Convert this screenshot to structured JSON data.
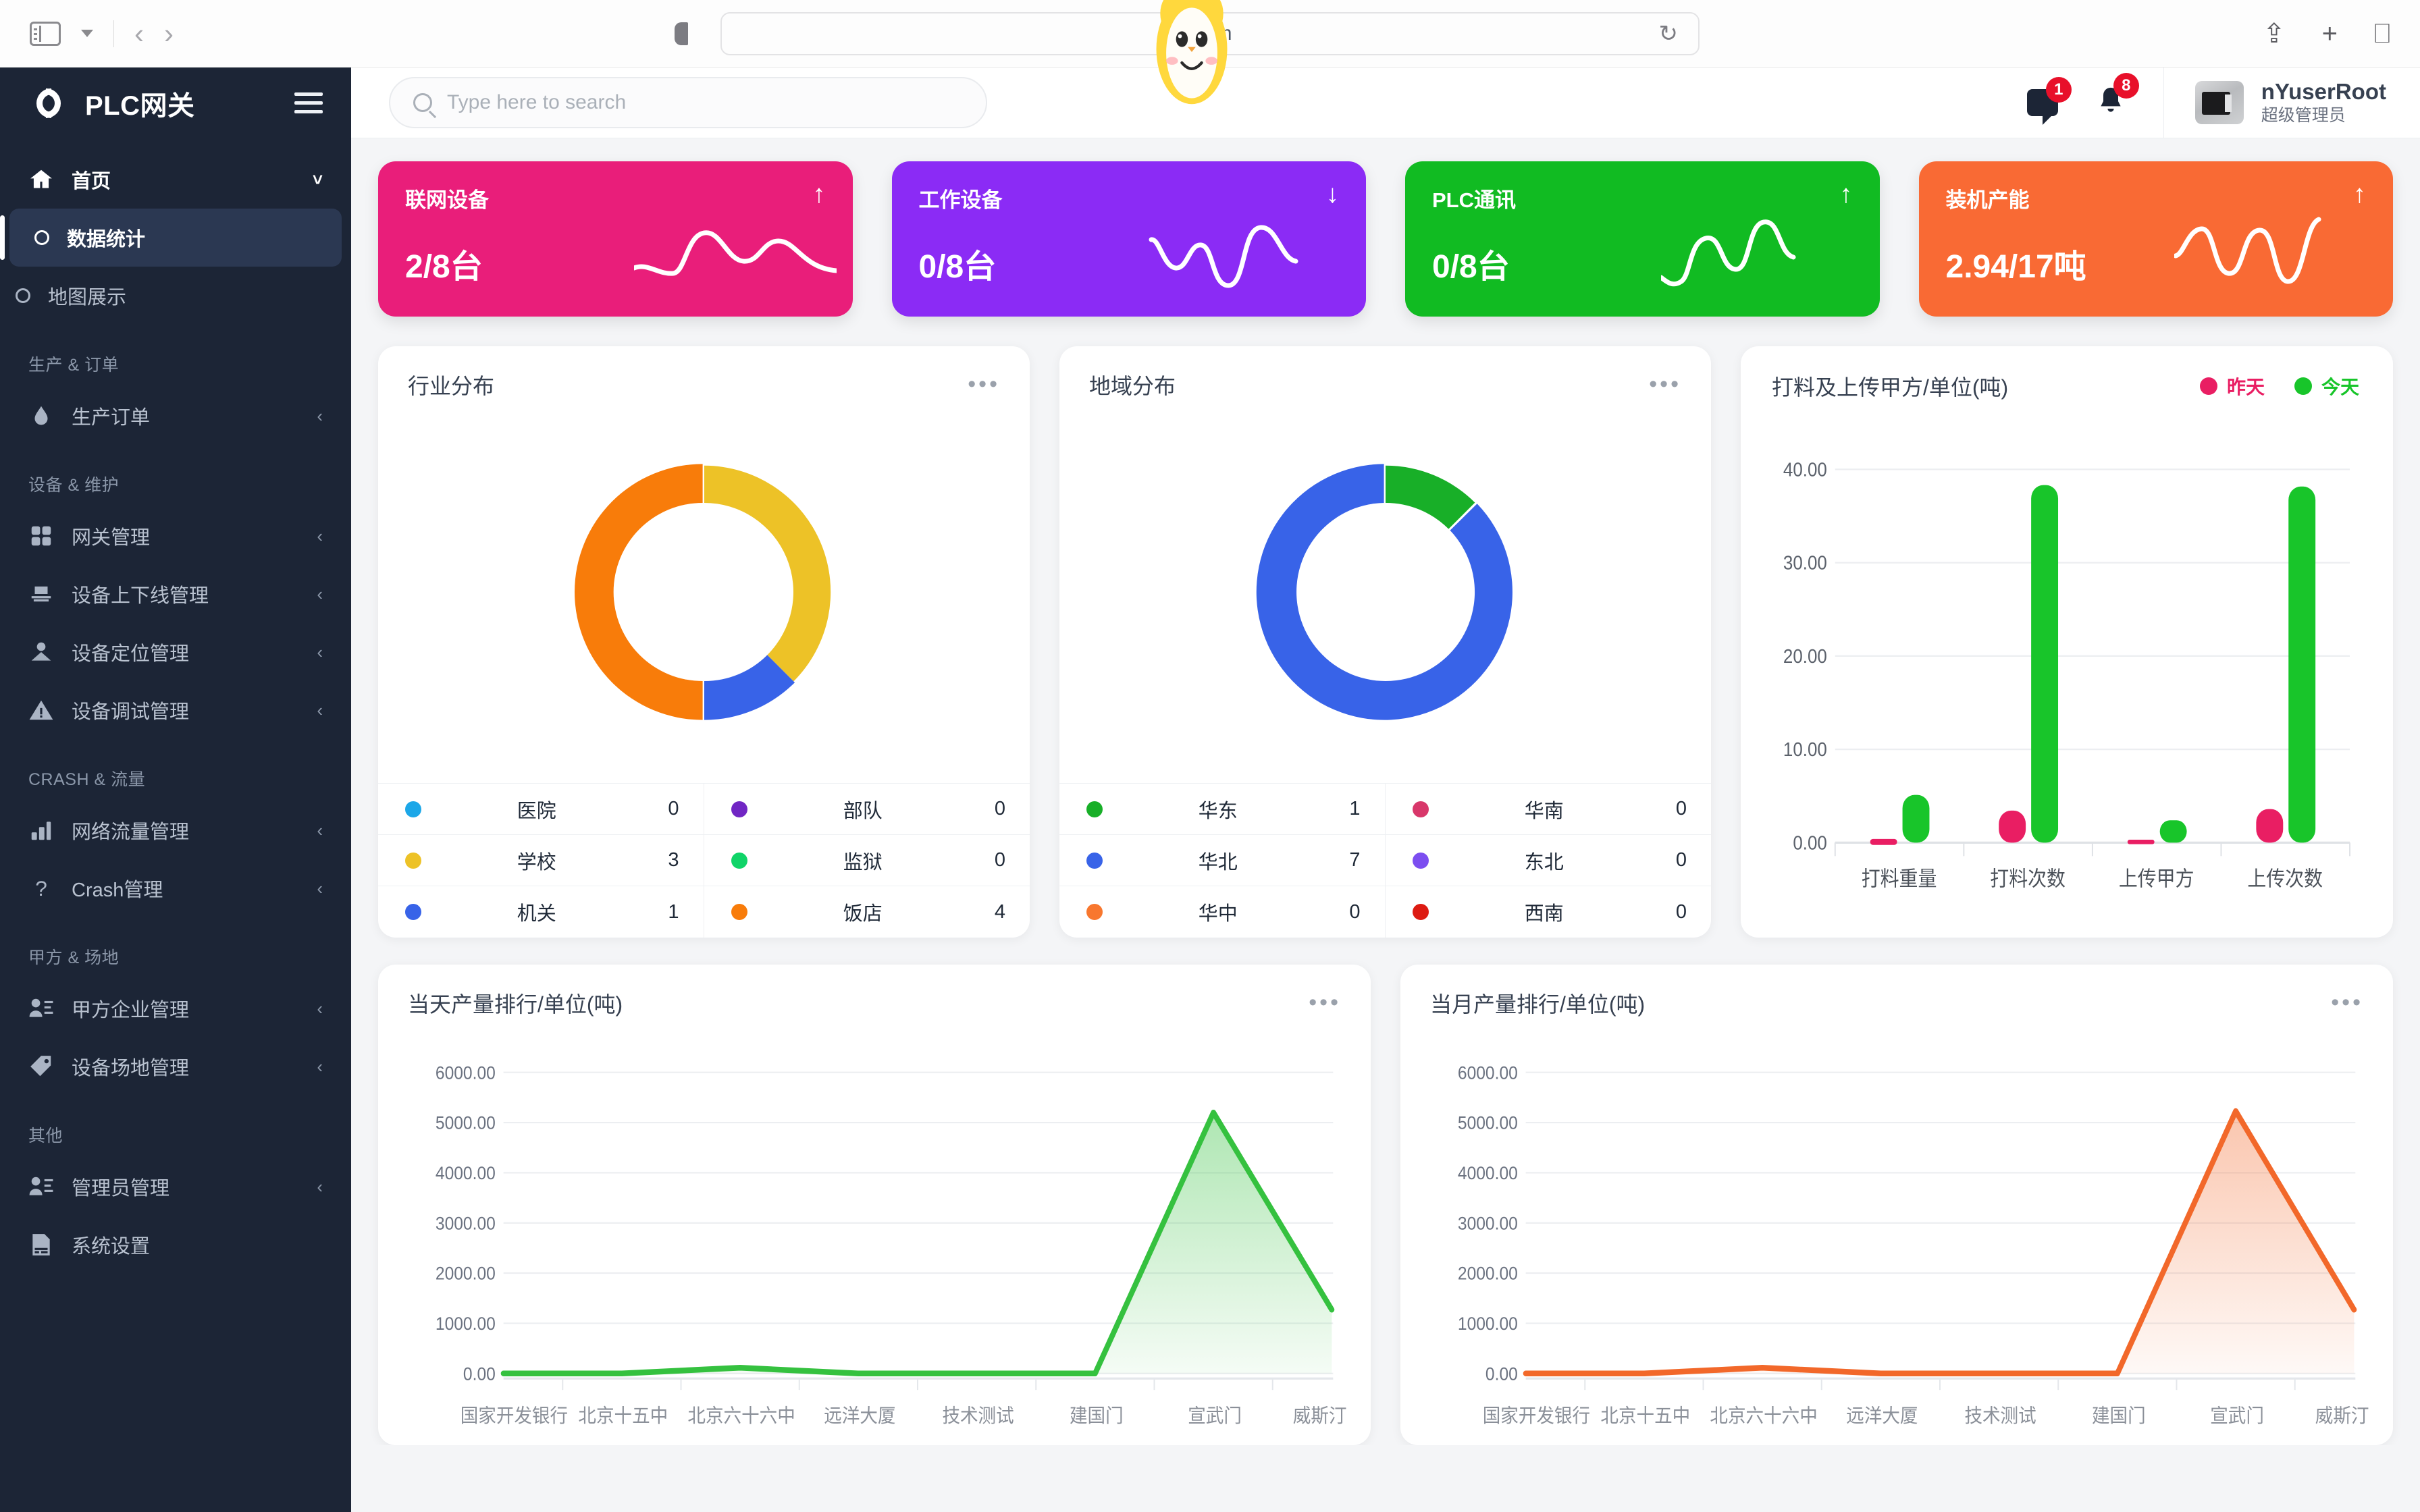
{
  "browser": {
    "url": ".com",
    "back_icon": "chevron-left-icon",
    "forward_icon": "chevron-right-icon",
    "sidebar_icon": "sidebar-toggle-icon",
    "shield_icon": "shield-icon",
    "reload_icon": "reload-icon",
    "share_icon": "share-icon",
    "new_tab_icon": "plus-icon",
    "tabs_icon": "tabs-overview-icon"
  },
  "sidebar": {
    "brand": "PLC网关",
    "logo_icon": "plc-logo-icon",
    "hamburger_icon": "hamburger-icon",
    "items": [
      {
        "label": "首页",
        "icon": "home-icon",
        "type": "parent",
        "active": true,
        "expanded": true
      },
      {
        "label": "数据统计",
        "icon": "circle-icon",
        "type": "child",
        "active": true
      },
      {
        "label": "地图展示",
        "icon": "circle-icon",
        "type": "child",
        "active": false
      }
    ],
    "groups": [
      {
        "title": "生产 & 订单",
        "items": [
          {
            "label": "生产订单",
            "icon": "drop-icon"
          }
        ]
      },
      {
        "title": "设备 & 维护",
        "items": [
          {
            "label": "网关管理",
            "icon": "grid-icon"
          },
          {
            "label": "设备上下线管理",
            "icon": "device-icon"
          },
          {
            "label": "设备定位管理",
            "icon": "location-pin-icon"
          },
          {
            "label": "设备调试管理",
            "icon": "warning-triangle-icon"
          }
        ]
      },
      {
        "title": "CRASH & 流量",
        "items": [
          {
            "label": "网络流量管理",
            "icon": "bar-chart-icon"
          },
          {
            "label": "Crash管理",
            "icon": "question-mark-icon"
          }
        ]
      },
      {
        "title": "甲方 & 场地",
        "items": [
          {
            "label": "甲方企业管理",
            "icon": "user-list-icon"
          },
          {
            "label": "设备场地管理",
            "icon": "tag-icon"
          }
        ]
      },
      {
        "title": "其他",
        "items": [
          {
            "label": "管理员管理",
            "icon": "user-list-icon"
          },
          {
            "label": "系统设置",
            "icon": "settings-card-icon"
          }
        ]
      }
    ]
  },
  "topbar": {
    "search_placeholder": "Type here to search",
    "search_value": "",
    "search_icon": "search-icon",
    "chat_icon": "chat-icon",
    "chat_badge": "1",
    "bell_icon": "bell-icon",
    "bell_badge": "8",
    "avatar_icon": "avatar",
    "user_name": "nYuserRoot",
    "user_role": "超级管理员"
  },
  "kpis": [
    {
      "title": "联网设备",
      "value": "2/8台",
      "arrow": "↑",
      "color": "#e91e7a"
    },
    {
      "title": "工作设备",
      "value": "0/8台",
      "arrow": "↓",
      "color": "#8b2bf5"
    },
    {
      "title": "PLC通讯",
      "value": "0/8台",
      "arrow": "↑",
      "color": "#11bb22"
    },
    {
      "title": "装机产能",
      "value": "2.94/17吨",
      "arrow": "↑",
      "color": "#f96a34"
    }
  ],
  "chart_data": [
    {
      "type": "pie",
      "title": "行业分布",
      "legend_position": "bottom",
      "categories": [
        "医院",
        "学校",
        "机关",
        "部队",
        "监狱",
        "饭店"
      ],
      "values": [
        0,
        3,
        1,
        0,
        0,
        4
      ],
      "colors": [
        "#1ca7e8",
        "#edc227",
        "#3863e8",
        "#7126c4",
        "#10d468",
        "#f87c0a"
      ]
    },
    {
      "type": "pie",
      "title": "地域分布",
      "legend_position": "bottom",
      "categories": [
        "华东",
        "华北",
        "华中",
        "华南",
        "东北",
        "西南"
      ],
      "values": [
        1,
        7,
        0,
        0,
        0,
        0
      ],
      "colors": [
        "#18af28",
        "#3863e8",
        "#f8772e",
        "#d8376a",
        "#7c4ef0",
        "#dd1b12"
      ]
    },
    {
      "type": "bar",
      "title": "打料及上传甲方/单位(吨)",
      "categories": [
        "打料重量",
        "打料次数",
        "上传甲方",
        "上传次数"
      ],
      "series": [
        {
          "name": "昨天",
          "values": [
            0.4,
            3.4,
            0.3,
            3.6
          ],
          "color": "#e91e63"
        },
        {
          "name": "今天",
          "values": [
            5.1,
            38.3,
            2.4,
            38.2
          ],
          "color": "#18c52a"
        }
      ],
      "ylabel": "",
      "xlabel": "",
      "ylim": [
        0,
        40
      ],
      "yticks": [
        "0.00",
        "10.00",
        "20.00",
        "30.00",
        "40.00"
      ],
      "grid": true,
      "legend_position": "top-right"
    },
    {
      "type": "area",
      "title": "当天产量排行/单位(吨)",
      "categories": [
        "国家开发银行",
        "北京十五中",
        "北京六十六中",
        "远洋大厦",
        "技术测试",
        "建国门",
        "宣武门",
        "威斯汀"
      ],
      "values": [
        0,
        0,
        110,
        0,
        0,
        0,
        5200,
        1270
      ],
      "color": "#35c13f",
      "ylim": [
        0,
        6000
      ],
      "yticks": [
        "0.00",
        "1000.00",
        "2000.00",
        "3000.00",
        "4000.00",
        "5000.00",
        "6000.00"
      ],
      "grid": true
    },
    {
      "type": "area",
      "title": "当月产量排行/单位(吨)",
      "categories": [
        "国家开发银行",
        "北京十五中",
        "北京六十六中",
        "远洋大厦",
        "技术测试",
        "建国门",
        "宣武门",
        "威斯汀"
      ],
      "values": [
        0,
        0,
        110,
        0,
        0,
        0,
        5230,
        1270
      ],
      "color": "#f2682a",
      "ylim": [
        0,
        6000
      ],
      "yticks": [
        "0.00",
        "1000.00",
        "2000.00",
        "3000.00",
        "4000.00",
        "5000.00",
        "6000.00"
      ],
      "grid": true
    }
  ],
  "cards": {
    "industry_title": "行业分布",
    "region_title": "地域分布",
    "bar_title": "打料及上传甲方/单位(吨)",
    "day_title": "当天产量排行/单位(吨)",
    "month_title": "当月产量排行/单位(吨)",
    "more_icon": "more-horizontal-icon",
    "legend_yesterday": "昨天",
    "legend_today": "今天"
  }
}
